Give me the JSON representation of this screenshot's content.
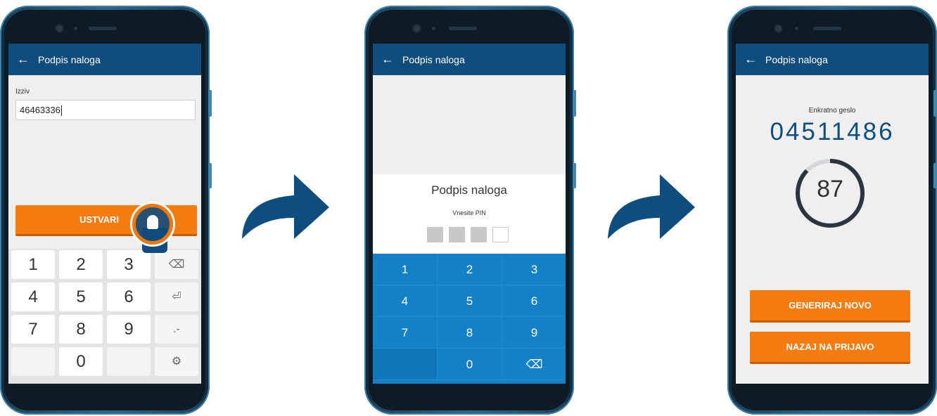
{
  "app": {
    "title": "Podpis naloga",
    "accent": "#0f4d7e",
    "button_color": "#f57c10",
    "keypad_color": "#1480c6"
  },
  "screen1": {
    "field_label": "Izziv",
    "field_value": "46463336",
    "button": "USTVARI",
    "keys": [
      [
        "1",
        "2",
        "3",
        "⌫"
      ],
      [
        "4",
        "5",
        "6",
        "⏎"
      ],
      [
        "7",
        "8",
        "9",
        ".-"
      ],
      [
        "",
        "0",
        "",
        "⚙"
      ]
    ]
  },
  "screen2": {
    "sheet_title": "Podpis naloga",
    "pin_prompt": "Vnesite PIN",
    "pin_filled": 3,
    "pin_length": 4,
    "keys": [
      [
        "1",
        "2",
        "3"
      ],
      [
        "4",
        "5",
        "6"
      ],
      [
        "7",
        "8",
        "9"
      ],
      [
        "",
        "0",
        "⌫"
      ]
    ]
  },
  "screen3": {
    "otp_label": "Enkratno geslo",
    "otp": "04511486",
    "countdown": "87",
    "btn_new": "GENERIRAJ NOVO",
    "btn_back": "NAZAJ NA PRIJAVO"
  },
  "icons": {
    "back": "arrow-left-icon",
    "flow": "curved-arrow-icon",
    "touch": "finger-touch-icon"
  }
}
